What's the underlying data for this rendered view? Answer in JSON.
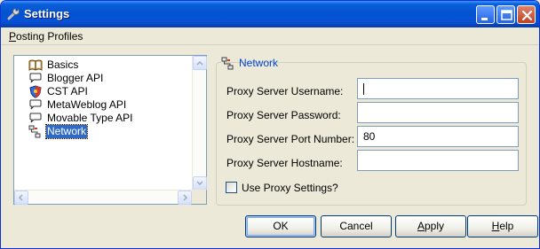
{
  "window": {
    "title": "Settings",
    "accent": "#0453d1"
  },
  "menu": {
    "items": [
      {
        "label": "Posting Profiles",
        "mnemonic": "P"
      }
    ]
  },
  "tree": {
    "items": [
      {
        "label": "Basics",
        "icon": "book-icon",
        "selected": false
      },
      {
        "label": "Blogger API",
        "icon": "speech-bubble-icon",
        "selected": false
      },
      {
        "label": "CST API",
        "icon": "shield-icon",
        "selected": false
      },
      {
        "label": "MetaWeblog API",
        "icon": "speech-bubble-icon",
        "selected": false
      },
      {
        "label": "Movable Type API",
        "icon": "speech-bubble-icon",
        "selected": false
      },
      {
        "label": "Network",
        "icon": "network-icon",
        "selected": true
      }
    ]
  },
  "network": {
    "heading": "Network",
    "fields": [
      {
        "label": "Proxy Server Username:",
        "value": ""
      },
      {
        "label": "Proxy Server Password:",
        "value": ""
      },
      {
        "label": "Proxy Server Port Number:",
        "value": "80"
      },
      {
        "label": "Proxy Server Hostname:",
        "value": ""
      }
    ],
    "use_proxy": {
      "label": "Use Proxy Settings?",
      "checked": false
    }
  },
  "buttons": {
    "ok": "OK",
    "cancel": "Cancel",
    "apply": {
      "label": "Apply",
      "mnemonic": "A"
    },
    "help": {
      "label": "Help",
      "mnemonic": "H"
    }
  }
}
